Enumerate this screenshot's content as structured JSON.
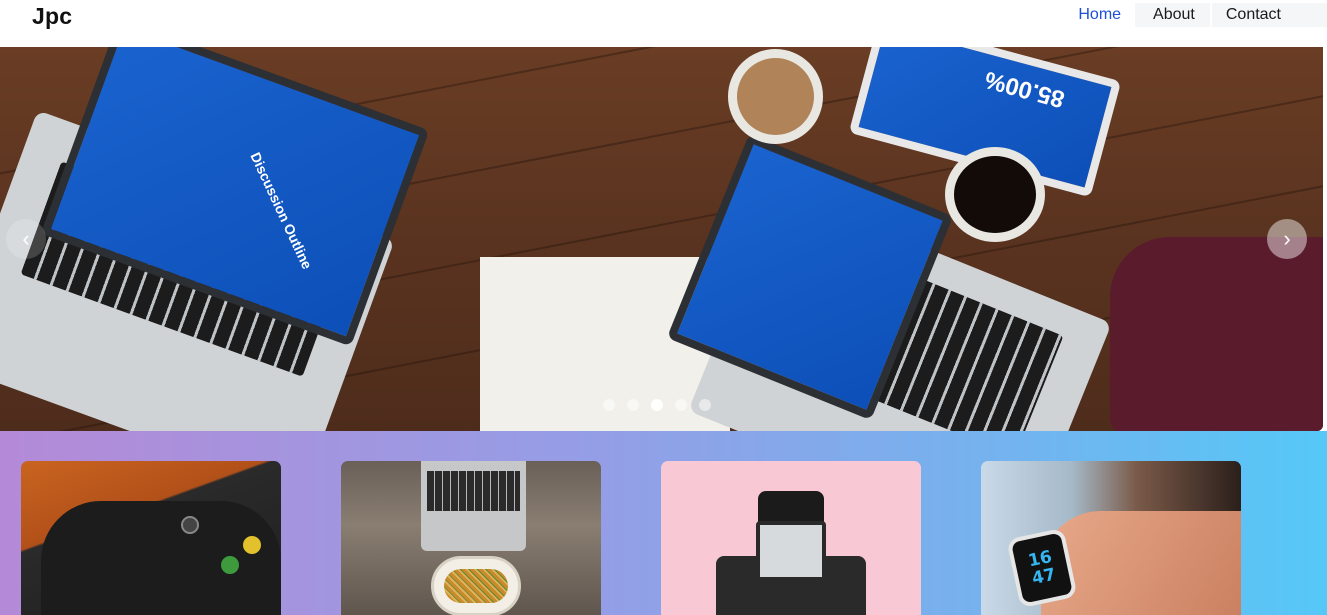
{
  "header": {
    "brand": "Jpc",
    "nav": [
      {
        "label": "Home",
        "active": true
      },
      {
        "label": "About",
        "active": false
      },
      {
        "label": "Contact",
        "active": false
      }
    ],
    "accent_color": "#1e4fd8"
  },
  "carousel": {
    "slide_count": 5,
    "active_index": 2,
    "prev_icon": "chevron-left-icon",
    "next_icon": "chevron-right-icon",
    "screen_text": "Discussion Outline",
    "tablet_text": "85.00%"
  },
  "cards": [
    {
      "image": "game-controller"
    },
    {
      "image": "laptop-and-noodles"
    },
    {
      "image": "camera-on-pink"
    },
    {
      "image": "smartwatch"
    }
  ],
  "cards_watch_text": [
    "16",
    "47"
  ]
}
